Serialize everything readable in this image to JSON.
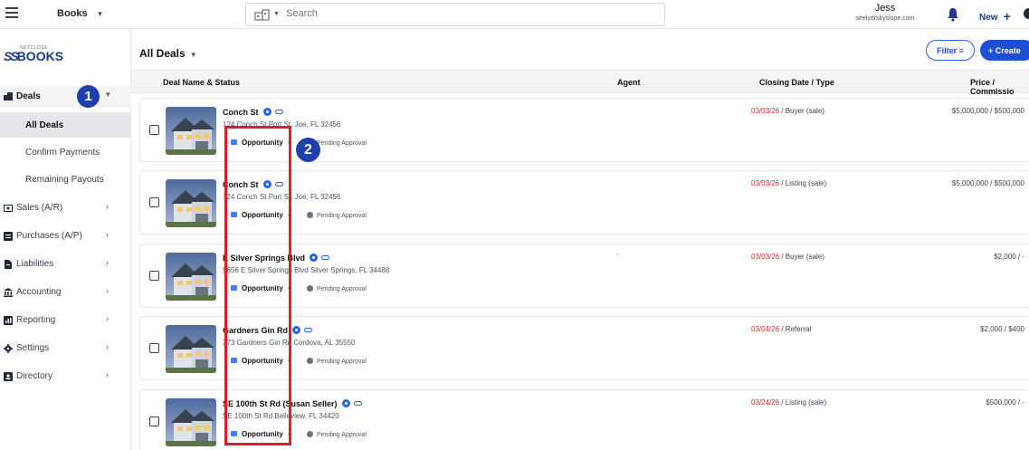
{
  "topbar": {
    "app_name": "Books",
    "search_placeholder": "Search",
    "user_name": "Jess",
    "user_email": "seelydrskyslope.com",
    "new_label": "New"
  },
  "sidebar": {
    "logo_small": "NETCLOSE",
    "logo_ss": "SS",
    "logo_text": "BOOKS",
    "deals_label": "Deals",
    "sub_items": [
      "All Deals",
      "Confirm Payments",
      "Remaining Payouts"
    ],
    "items": [
      {
        "label": "Sales (A/R)",
        "icon": "dollar-icon"
      },
      {
        "label": "Purchases (A/P)",
        "icon": "list-icon"
      },
      {
        "label": "Liabilities",
        "icon": "file-icon"
      },
      {
        "label": "Accounting",
        "icon": "bank-icon"
      },
      {
        "label": "Reporting",
        "icon": "chart-icon"
      },
      {
        "label": "Settings",
        "icon": "gear-icon"
      },
      {
        "label": "Directory",
        "icon": "contacts-icon"
      }
    ]
  },
  "markers": {
    "one": "1",
    "two": "2"
  },
  "main": {
    "title": "All Deals",
    "filter_label": "Filter",
    "create_label": "+ Create",
    "columns": {
      "name": "Deal Name & Status",
      "agent": "Agent",
      "closing": "Closing Date / Type",
      "price": "Price / Commissio"
    },
    "deals": [
      {
        "name": "Conch St",
        "address": "124 Conch St Port St. Joe, FL 32456",
        "status": "Opportunity",
        "approval": "Pending Approval",
        "date": "03/03/26",
        "type": " / Buyer (sale)",
        "price": "$5,000,000 / $500,000",
        "agent": ""
      },
      {
        "name": "Conch St",
        "address": "124 Conch St Port St. Joe, FL 32456",
        "status": "Opportunity",
        "approval": "Pending Approval",
        "date": "03/03/26",
        "type": " / Listing (sale)",
        "price": "$5,000,000 / $500,000",
        "agent": ""
      },
      {
        "name": "E Silver Springs Blvd",
        "address": "5656 E Silver Springs Blvd Silver Springs, FL 34488",
        "status": "Opportunity",
        "approval": "Pending Approval",
        "date": "03/03/26",
        "type": " / Buyer (sale)",
        "price": "$2,000 / -",
        "agent": "-"
      },
      {
        "name": "Gardners Gin Rd",
        "address": "373 Gardners Gin Rd Cordova, AL 35550",
        "status": "Opportunity",
        "approval": "Pending Approval",
        "date": "03/04/26",
        "type": " / Referral",
        "price": "$2,000 / $400",
        "agent": ""
      },
      {
        "name": "SE 100th St Rd (Susan Seller)",
        "address": "SE 100th St Rd Belleview, FL 34420",
        "status": "Opportunity",
        "approval": "Pending Approval",
        "date": "03/24/26",
        "type": " / Listing (sale)",
        "price": "$500,000 / -",
        "agent": ""
      }
    ]
  }
}
